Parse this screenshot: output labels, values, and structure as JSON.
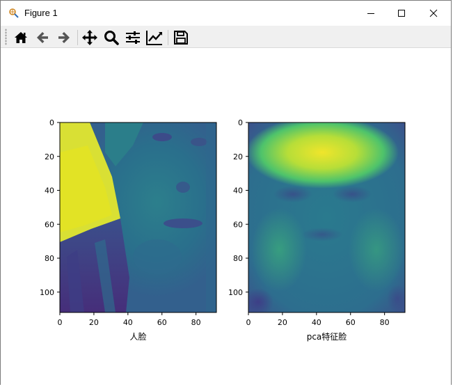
{
  "window": {
    "title": "Figure 1",
    "icons": {
      "app": "matplotlib-figure-icon",
      "minimize": "minimize-icon",
      "maximize": "maximize-icon",
      "close": "close-icon"
    }
  },
  "toolbar": {
    "buttons": [
      {
        "name": "home-icon",
        "label": "Home"
      },
      {
        "name": "back-arrow-icon",
        "label": "Back"
      },
      {
        "name": "forward-arrow-icon",
        "label": "Forward"
      },
      {
        "name": "pan-icon",
        "label": "Pan"
      },
      {
        "name": "zoom-icon",
        "label": "Zoom"
      },
      {
        "name": "subplots-icon",
        "label": "Subplots"
      },
      {
        "name": "edit-axes-icon",
        "label": "Customize"
      },
      {
        "name": "save-icon",
        "label": "Save"
      }
    ]
  },
  "figure": {
    "subplots": [
      {
        "xlabel": "人脸",
        "xticks": [
          "0",
          "20",
          "40",
          "60",
          "80"
        ],
        "yticks": [
          "0",
          "20",
          "40",
          "60",
          "80",
          "100"
        ],
        "xrange": [
          0,
          92
        ],
        "yrange": [
          0,
          112
        ],
        "image": "face photo (viridis colormap)"
      },
      {
        "xlabel": "pca特征脸",
        "xticks": [
          "0",
          "20",
          "40",
          "60",
          "80"
        ],
        "yticks": [
          "0",
          "20",
          "40",
          "60",
          "80",
          "100"
        ],
        "xrange": [
          0,
          92
        ],
        "yrange": [
          0,
          112
        ],
        "image": "pca eigenface (viridis colormap)"
      }
    ],
    "colors": {
      "viridis_dark": "#440154",
      "viridis_blue": "#31688e",
      "viridis_teal": "#21918c",
      "viridis_green": "#5ec962",
      "viridis_yellow": "#fde725"
    }
  }
}
